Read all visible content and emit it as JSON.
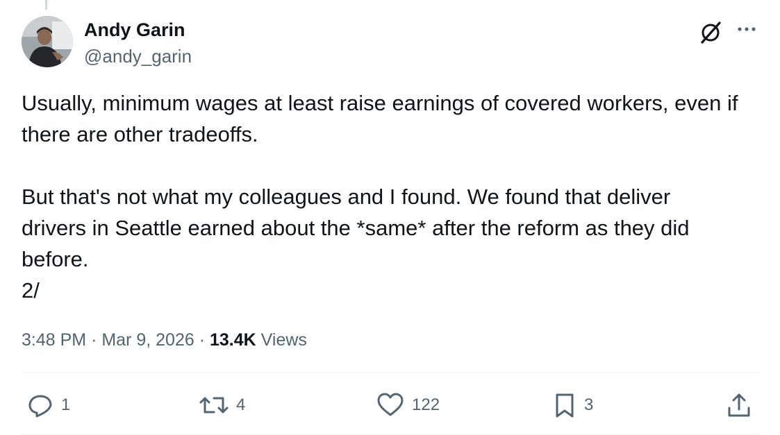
{
  "author": {
    "name": "Andy Garin",
    "handle": "@andy_garin"
  },
  "tweet": {
    "text": "Usually, minimum wages at least raise earnings of covered workers, even if\nthere are other tradeoffs.\n\nBut that's not what my colleagues and I found. We found that deliver\ndrivers in Seattle earned about the *same* after the reform as they did\nbefore.\n2/",
    "time": "3:48 PM",
    "date": "Mar 9, 2026",
    "separator": "·",
    "views_count": "13.4K",
    "views_label": "Views"
  },
  "actions": {
    "replies": "1",
    "reposts": "4",
    "likes": "122",
    "bookmarks": "3"
  },
  "icons": {
    "avatar": "avatar-photo",
    "grok": "grok-slash-circle-icon",
    "more": "ellipsis-icon",
    "reply": "speech-bubble-icon",
    "repost": "repost-arrows-icon",
    "like": "heart-icon",
    "bookmark": "bookmark-icon",
    "share": "share-upload-icon"
  },
  "colors": {
    "text": "#0f1419",
    "secondary": "#536471",
    "divider": "#eff3f4"
  }
}
